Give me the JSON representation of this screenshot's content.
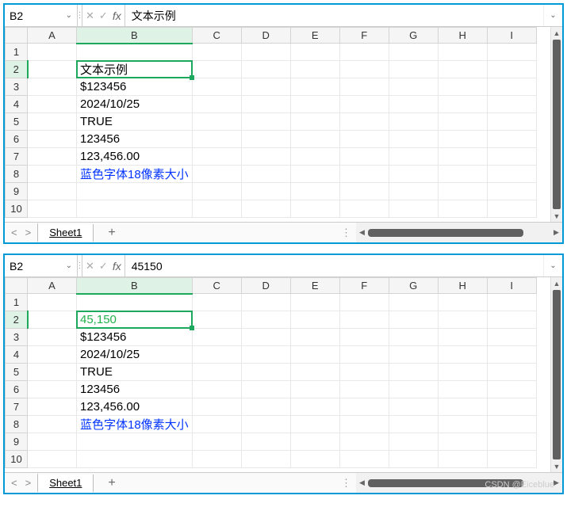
{
  "panels": [
    {
      "name_box": "B2",
      "formula_value": "文本示例",
      "b2_style": "black",
      "cells": {
        "b2": "文本示例",
        "b3": "$123456",
        "b4": "2024/10/25",
        "b5": "TRUE",
        "b6": "123456",
        "b7": "123,456.00",
        "b8": "蓝色字体18像素大小"
      },
      "sheet_name": "Sheet1"
    },
    {
      "name_box": "B2",
      "formula_value": "45150",
      "b2_style": "green",
      "cells": {
        "b2": "45,150",
        "b3": "$123456",
        "b4": "2024/10/25",
        "b5": "TRUE",
        "b6": "123456",
        "b7": "123,456.00",
        "b8": "蓝色字体18像素大小"
      },
      "sheet_name": "Sheet1"
    }
  ],
  "columns": [
    "A",
    "B",
    "C",
    "D",
    "E",
    "F",
    "G",
    "H",
    "I"
  ],
  "rows": [
    "1",
    "2",
    "3",
    "4",
    "5",
    "6",
    "7",
    "8",
    "9",
    "10"
  ],
  "watermark": "CSDN @Eiceblue",
  "fx_label": "fx",
  "add_sheet_label": "+"
}
